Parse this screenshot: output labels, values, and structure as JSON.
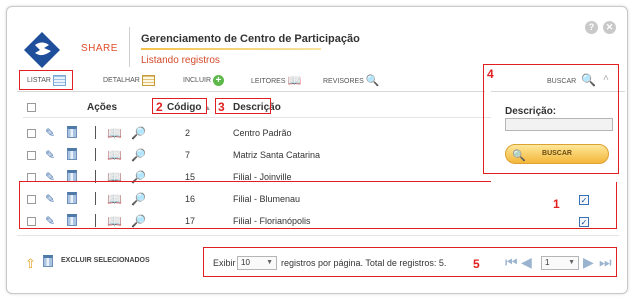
{
  "app": {
    "brand": "SHARE",
    "title": "Gerenciamento de Centro de Participação",
    "subtitle": "Listando registros",
    "help_glyph": "?",
    "close_glyph": "✕"
  },
  "tabs": [
    {
      "label": "LISTAR",
      "icon": "list-icon"
    },
    {
      "label": "DETALHAR",
      "icon": "detail-icon"
    },
    {
      "label": "INCLUIR",
      "icon": "add-icon"
    },
    {
      "label": "LEITORES",
      "icon": "readers-icon"
    },
    {
      "label": "REVISORES",
      "icon": "reviewers-icon"
    }
  ],
  "table": {
    "col_actions": "Ações",
    "col_code": "Código",
    "col_code_sort": "▲",
    "col_desc": "Descrição",
    "rows": [
      {
        "code": "2",
        "description": "Centro Padrão",
        "selected": false
      },
      {
        "code": "7",
        "description": "Matriz Santa Catarina",
        "selected": false
      },
      {
        "code": "15",
        "description": "Filial - Joinville",
        "selected": false
      },
      {
        "code": "16",
        "description": "Filial - Blumenau",
        "selected": true
      },
      {
        "code": "17",
        "description": "Filial - Florianópolis",
        "selected": true
      }
    ]
  },
  "search_panel": {
    "tab_label": "BUSCAR",
    "field_label": "Descrição:",
    "field_value": "",
    "button_label": "BUSCAR"
  },
  "footer": {
    "delete_label": "EXCLUIR SELECIONADOS",
    "show_prefix": "Exibir",
    "page_size": "10",
    "page_suffix": "registros por página. Total de registros: 5.",
    "current_page": "1"
  },
  "callouts": {
    "n1": "1",
    "n2": "2",
    "n3": "3",
    "n4": "4",
    "n5": "5"
  },
  "colors": {
    "callout": "#e02020",
    "accent": "#f3b63a",
    "brand": "#e04a2a"
  }
}
